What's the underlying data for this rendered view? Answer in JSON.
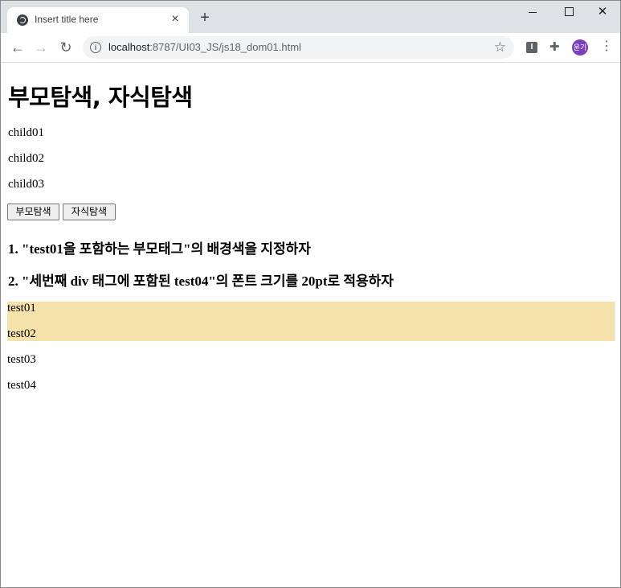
{
  "browser": {
    "tab_title": "Insert title here",
    "tab_close": "×",
    "new_tab": "+",
    "url_host": "localhost",
    "url_path": ":8787/UI03_JS/js18_dom01.html",
    "profile_initials": "윤기",
    "ext_label": "I",
    "icons": [
      "globe-icon",
      "back-arrow-icon",
      "forward-arrow-icon",
      "reload-icon",
      "info-icon",
      "star-icon",
      "puzzle-icon",
      "menu-dots-icon"
    ]
  },
  "page": {
    "heading": "부모탐색, 자식탐색",
    "children": [
      "child01",
      "child02",
      "child03"
    ],
    "buttons": {
      "parent": "부모탐색",
      "child": "자식탐색"
    },
    "task1": "1. \"test01을 포함하는 부모태그\"의 배경색을 지정하자",
    "task2": "2. \"세번째 div 태그에 포함된 test04\"의 폰트 크기를 20pt로 적용하자",
    "tests": [
      "test01",
      "test02",
      "test03",
      "test04"
    ],
    "highlight_color": "#f5e1aa"
  }
}
